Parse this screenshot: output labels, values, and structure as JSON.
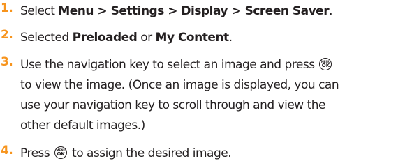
{
  "steps": [
    {
      "num": "1.",
      "lines": [
        {
          "parts": [
            "Select ",
            "Menu > Settings > Display > Screen Saver",
            "."
          ]
        }
      ]
    },
    {
      "num": "2.",
      "lines": [
        {
          "parts": [
            "Selected ",
            "Preloaded",
            " or ",
            "My Content",
            "."
          ]
        }
      ]
    },
    {
      "num": "3.",
      "lines": [
        {
          "parts": [
            "Use the navigation key to select an image and press "
          ]
        },
        {
          "parts": [
            "to view the image. (Once an image is displayed, you can"
          ]
        },
        {
          "parts": [
            "use your navigation key to scroll through and view the"
          ]
        },
        {
          "parts": [
            "other default images.)"
          ]
        }
      ]
    },
    {
      "num": "4.",
      "lines": [
        {
          "parts": [
            "Press ",
            " to assign the desired image."
          ]
        }
      ]
    }
  ],
  "key_icon": {
    "name": "menu-ok-key-icon",
    "top_text": "MENU",
    "bottom_text": "OK"
  }
}
